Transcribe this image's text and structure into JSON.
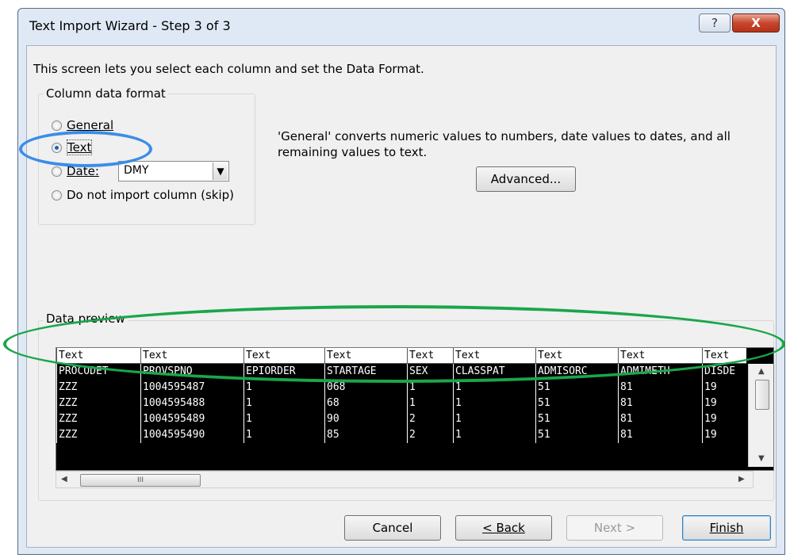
{
  "window": {
    "title": "Text Import Wizard - Step 3 of 3",
    "help_label": "?",
    "close_label": "X"
  },
  "intro_text": "This screen lets you select each column and set the Data Format.",
  "column_format": {
    "legend": "Column data format",
    "options": [
      {
        "id": "general",
        "label": "General",
        "checked": false
      },
      {
        "id": "text",
        "label": "Text",
        "checked": true
      },
      {
        "id": "date",
        "label": "Date:",
        "checked": false
      },
      {
        "id": "skip",
        "label": "Do not import column (skip)",
        "checked": false
      }
    ],
    "date_format_value": "DMY"
  },
  "description": "'General' converts numeric values to numbers, date values to dates, and all remaining values to text.",
  "advanced_button": "Advanced...",
  "preview": {
    "legend": "Data preview",
    "headers": [
      "Text",
      "Text",
      "Text",
      "Text",
      "Text",
      "Text",
      "Text",
      "Text",
      "Text"
    ],
    "rows": [
      [
        "PROCODET",
        "PROVSPNO",
        "EPIORDER",
        "STARTAGE",
        "SEX",
        "CLASSPAT",
        "ADMISORC",
        "ADMIMETH",
        "DISDE"
      ],
      [
        "ZZZ",
        "1004595487",
        "1",
        "068",
        "1",
        "1",
        "51",
        "81",
        "19"
      ],
      [
        "ZZZ",
        "1004595488",
        "1",
        "68",
        "1",
        "1",
        "51",
        "81",
        "19"
      ],
      [
        "ZZZ",
        "1004595489",
        "1",
        "90",
        "2",
        "1",
        "51",
        "81",
        "19"
      ],
      [
        "ZZZ",
        "1004595490",
        "1",
        "85",
        "2",
        "1",
        "51",
        "81",
        "19"
      ]
    ],
    "hscroll_grip": "III"
  },
  "buttons": {
    "cancel": "Cancel",
    "back": "< Back",
    "next": "Next >",
    "finish": "Finish"
  },
  "colors": {
    "annotation_blue": "#3b8de8",
    "annotation_green": "#1aa64a",
    "preview_background": "#000000"
  }
}
